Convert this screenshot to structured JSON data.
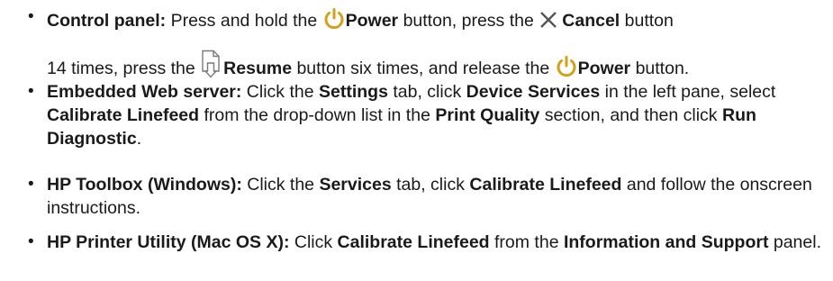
{
  "steps": {
    "control_panel": {
      "heading": "Control panel:",
      "t1": " Press and hold the ",
      "power": "Power",
      "t2": " button, press the ",
      "cancel": "Cancel",
      "t3": " button",
      "t4": "14 times, press the ",
      "resume": "Resume",
      "t5": " button six times, and release the ",
      "power2": "Power",
      "t6": " button."
    },
    "ews": {
      "heading": "Embedded Web server:",
      "t1": " Click the ",
      "settings": "Settings",
      "t2": " tab, click ",
      "device_services": "Device Services",
      "t3": " in the left pane, select ",
      "calibrate": "Calibrate Linefeed",
      "t4": " from the drop-down list in the ",
      "print_quality": "Print Quality",
      "t5": " section, and then click ",
      "run_diag": "Run Diagnostic",
      "t6": "."
    },
    "toolbox": {
      "heading": "HP Toolbox (Windows):",
      "t1": " Click the ",
      "services": "Services",
      "t2": " tab, click ",
      "calibrate": "Calibrate Linefeed",
      "t3": " and follow the onscreen instructions."
    },
    "utility": {
      "heading": "HP Printer Utility (Mac OS X):",
      "t1": " Click ",
      "calibrate": "Calibrate Linefeed",
      "t2": " from the ",
      "info_support": "Information and Support",
      "t3": " panel."
    }
  },
  "bullet_char": "•"
}
